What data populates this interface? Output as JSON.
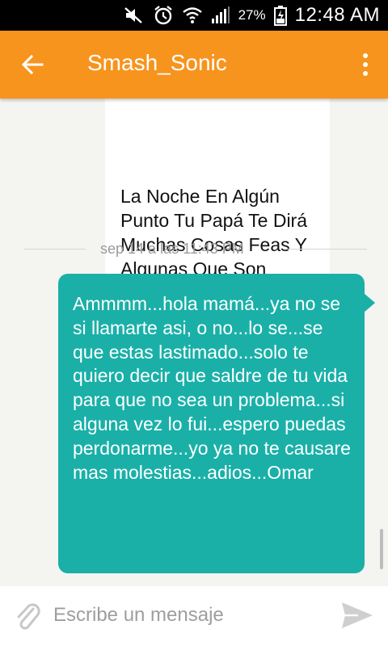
{
  "status_bar": {
    "battery_percent": "27%",
    "time": "12:48 AM",
    "icons": [
      "mute-icon",
      "alarm-icon",
      "wifi-icon",
      "signal-icon",
      "battery-charging-icon"
    ]
  },
  "header": {
    "title": "Smash_Sonic",
    "back_icon": "arrow-back-icon",
    "menu_icon": "overflow-menu-icon",
    "color": "#f7941d"
  },
  "conversation": {
    "incoming_message": "La Noche En Algún Punto Tu Papá Te Dirá Muchas Cosas Feas Y Algunas Que Son Verdad",
    "timestamp": "sep 14 a las 11:43 PM",
    "outgoing_message": "Ammmm...hola mamá...ya no se si llamarte asi, o no...lo se...se que estas lastimado...solo te quiero decir que saldre de tu vida para que no sea un problema...si alguna vez lo fui...espero puedas perdonarme...yo ya no te causare mas molestias...adios...Omar",
    "outgoing_color": "#1ab0a8"
  },
  "compose": {
    "placeholder": "Escribe un mensaje",
    "value": "",
    "attach_icon": "attach-icon",
    "send_icon": "send-icon"
  }
}
